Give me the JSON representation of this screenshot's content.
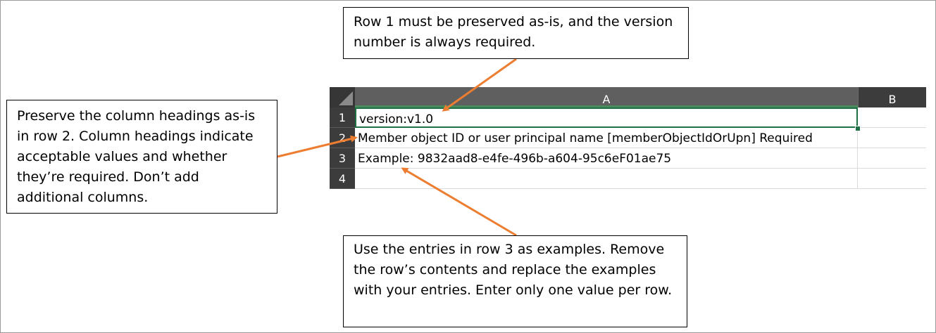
{
  "callouts": {
    "top": "Row 1 must be preserved as-is, and the version number is always required.",
    "left": "Preserve the column headings as-is in row 2. Column headings indicate acceptable values and whether they’re required. Don’t add additional columns.",
    "bottom": "Use the entries in row 3 as examples. Remove the row’s contents and replace the examples with your entries. Enter only one value per row."
  },
  "sheet": {
    "columns": [
      "A",
      "B"
    ],
    "rows": [
      {
        "number": "1",
        "value": "version:v1.0"
      },
      {
        "number": "2",
        "value": "Member object ID or user principal name [memberObjectIdOrUpn] Required"
      },
      {
        "number": "3",
        "value": "Example: 9832aad8-e4fe-496b-a604-95c6eF01ae75"
      },
      {
        "number": "4",
        "value": ""
      }
    ]
  },
  "colors": {
    "arrow": "#ed7d31",
    "header_bg": "#3c3c3c",
    "selection": "#1e7145"
  }
}
